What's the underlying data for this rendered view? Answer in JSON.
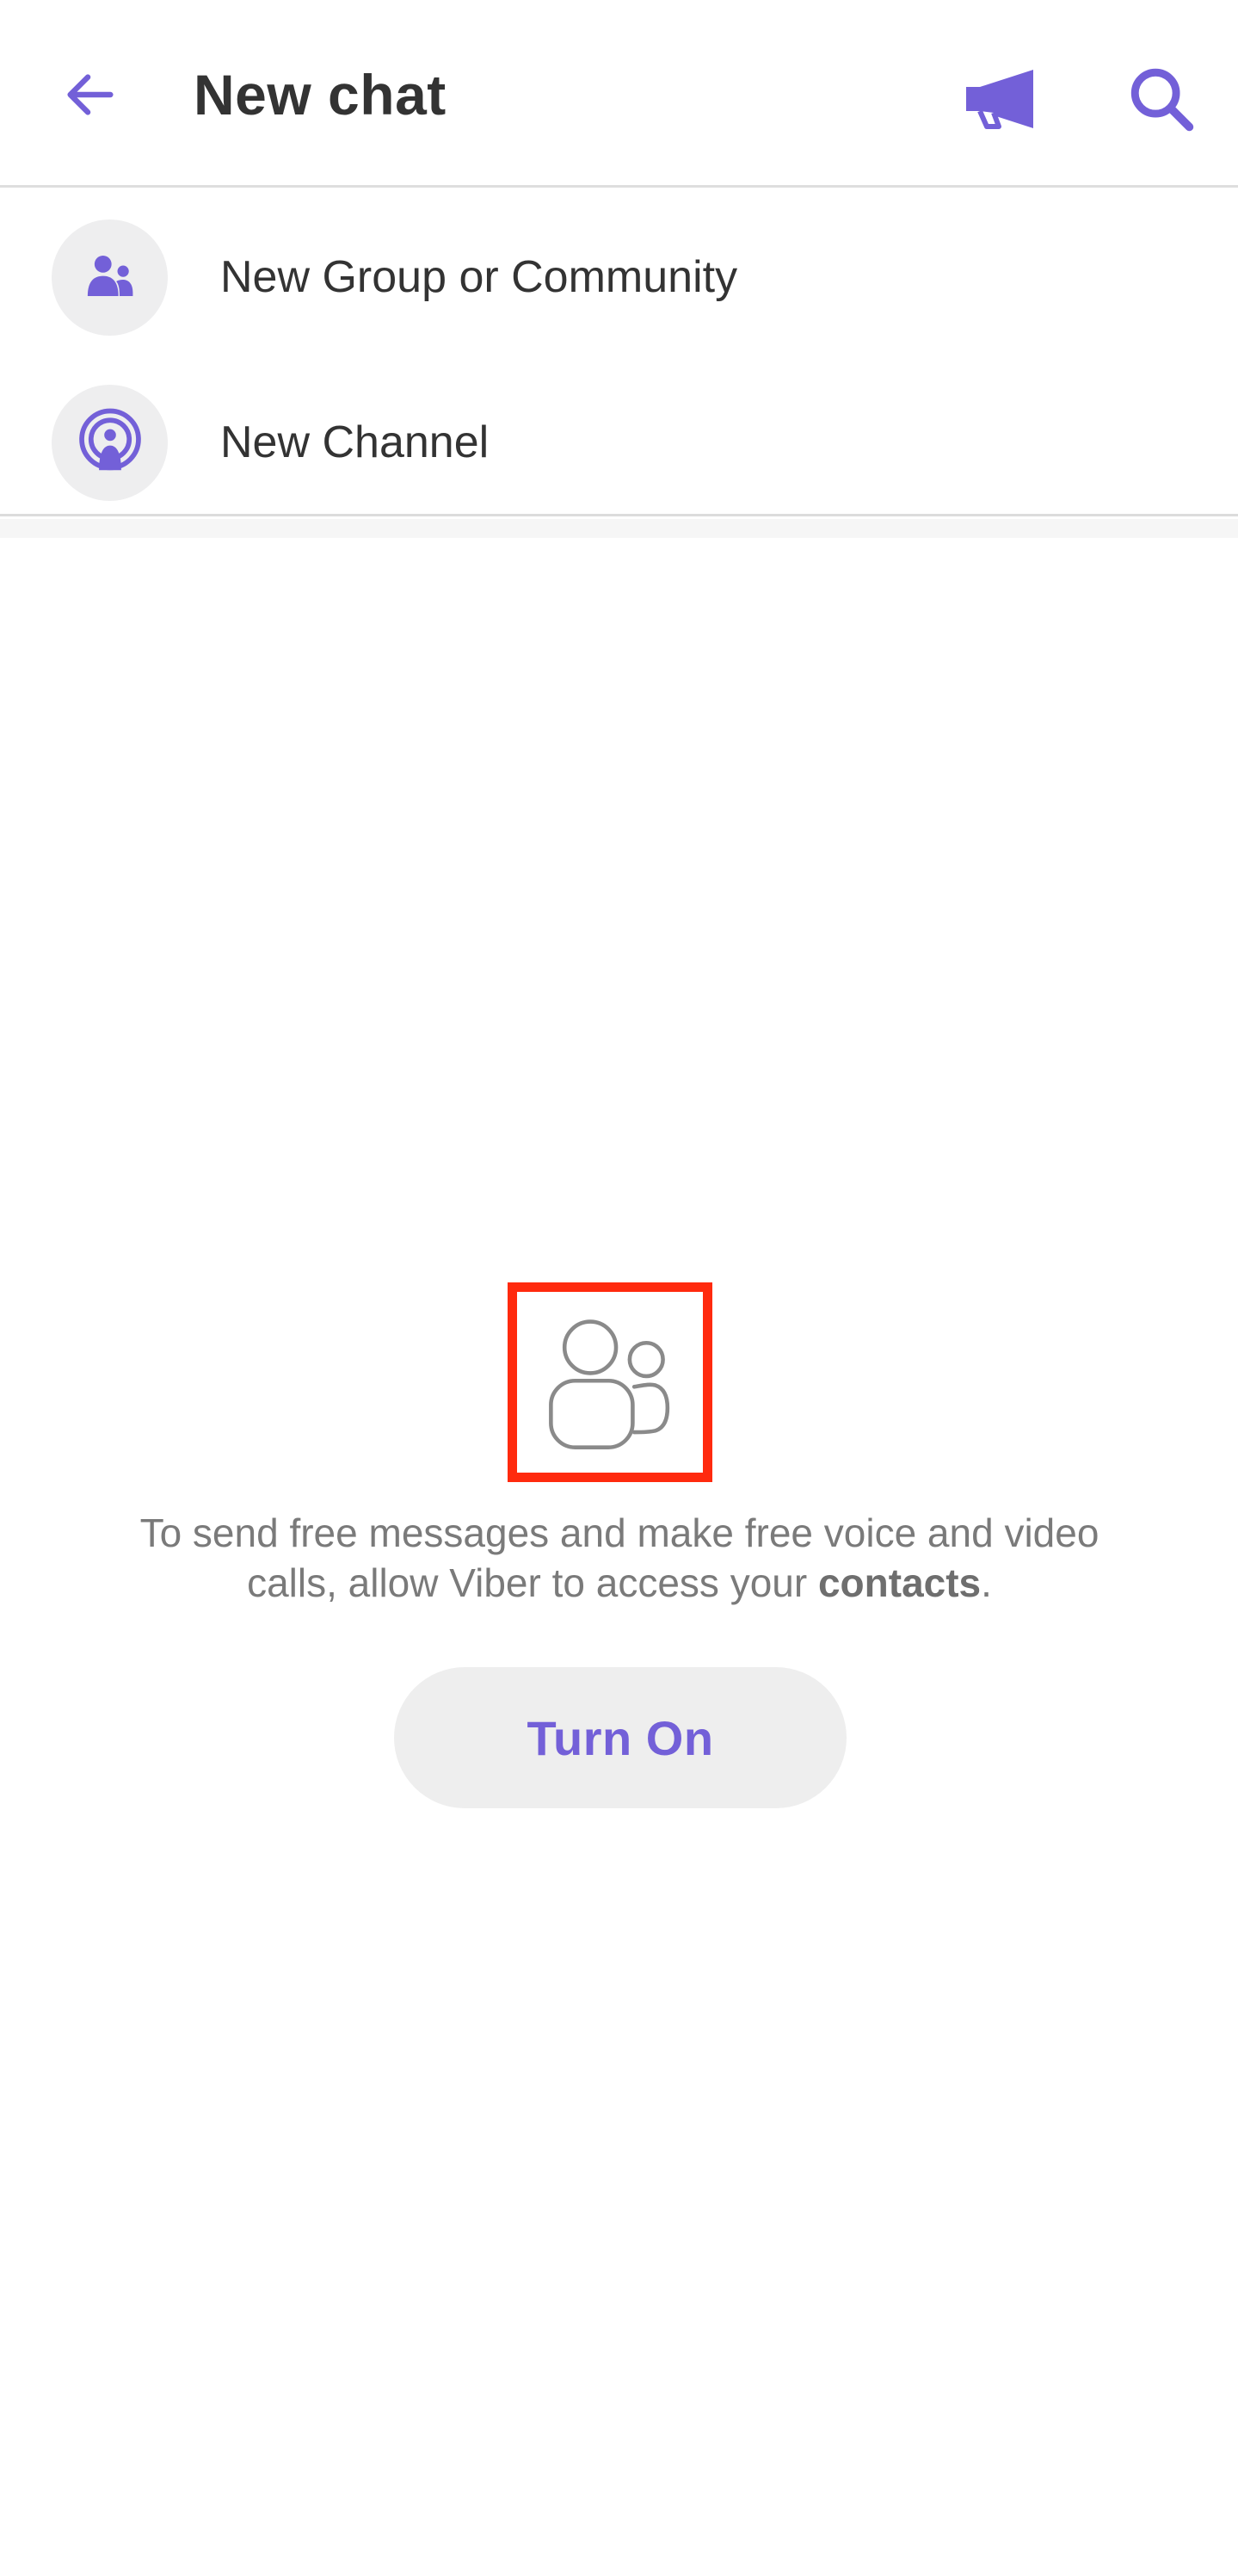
{
  "header": {
    "title": "New chat",
    "back_icon": "arrow-left-icon",
    "megaphone_icon": "megaphone-icon",
    "search_icon": "search-icon"
  },
  "menu": {
    "items": [
      {
        "label": "New Group or Community",
        "icon": "group-icon"
      },
      {
        "label": "New Channel",
        "icon": "channel-broadcast-icon"
      }
    ]
  },
  "empty_state": {
    "icon": "contacts-icon",
    "text_before": "To send free messages and make free voice and video calls, allow Viber to access your ",
    "text_bold": "contacts",
    "text_after": ".",
    "button_label": "Turn On"
  },
  "colors": {
    "accent": "#7360d8",
    "highlight_frame": "#ff2a0e",
    "icon_bg": "#eeeeef",
    "text_dark": "#333333",
    "text_muted": "#7a7a7a"
  }
}
